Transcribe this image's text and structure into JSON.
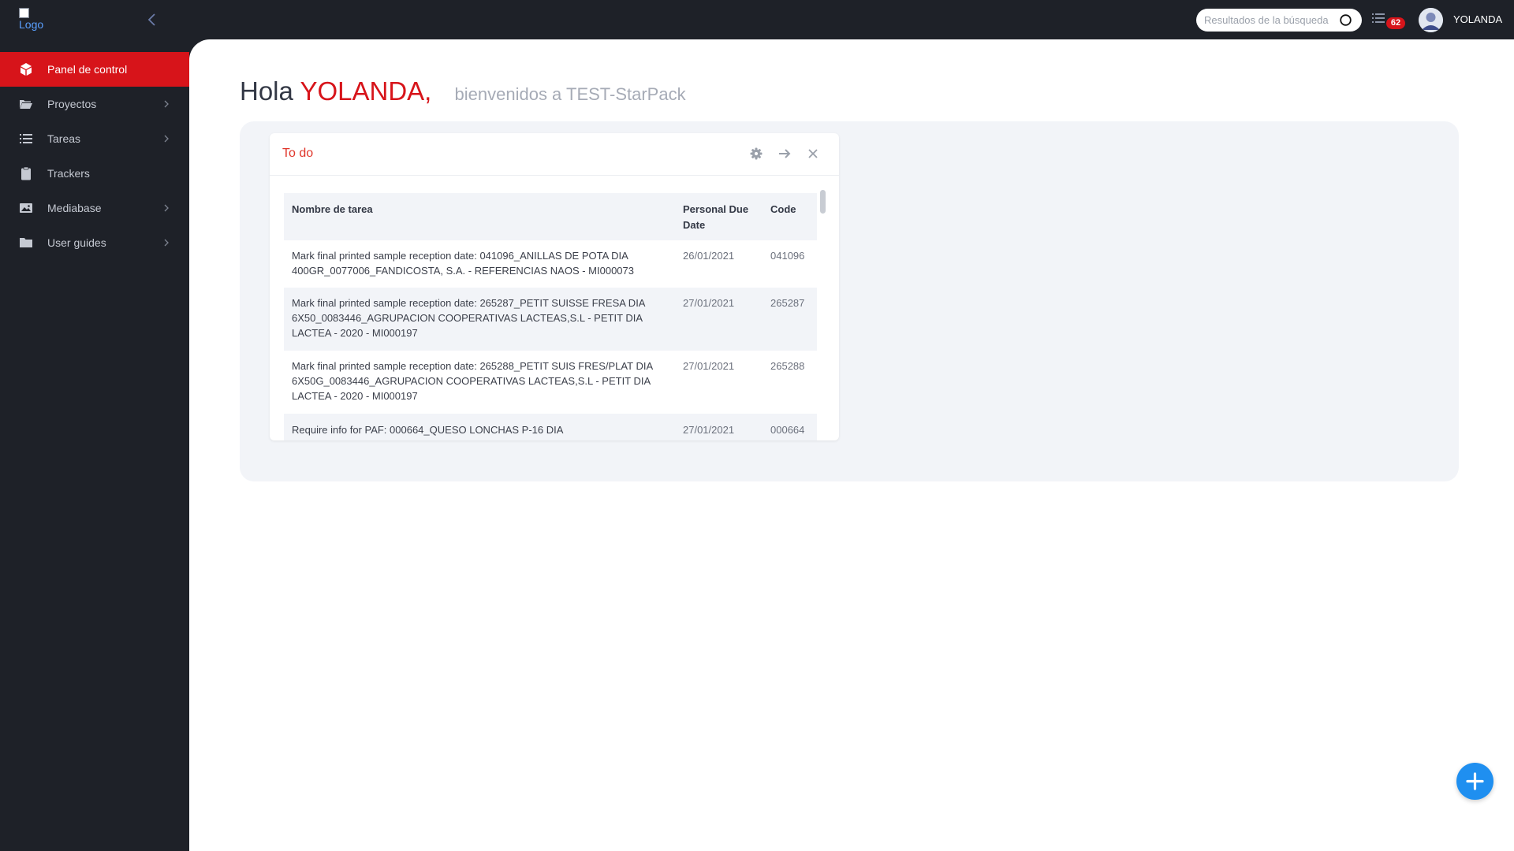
{
  "topbar": {
    "logo_alt": "Logo",
    "search_placeholder": "Resultados de la búsqueda",
    "tasks_badge": "62",
    "user_name": "YOLANDA"
  },
  "sidebar": {
    "items": [
      {
        "label": "Panel de control",
        "icon": "cube-icon",
        "active": true
      },
      {
        "label": "Proyectos",
        "icon": "folder-open-icon",
        "has_submenu": true
      },
      {
        "label": "Tareas",
        "icon": "list-icon",
        "has_submenu": true
      },
      {
        "label": "Trackers",
        "icon": "clipboard-icon"
      },
      {
        "label": "Mediabase",
        "icon": "image-icon",
        "has_submenu": true
      },
      {
        "label": "User guides",
        "icon": "folder-icon",
        "has_submenu": true
      }
    ]
  },
  "main": {
    "greeting_hello": "Hola",
    "greeting_name": "YOLANDA,",
    "greeting_welcome": "bienvenidos a TEST-StarPack",
    "widget": {
      "title": "To do",
      "columns": [
        "Nombre de tarea",
        "Personal Due Date",
        "Code"
      ],
      "rows": [
        {
          "task": "Mark final printed sample reception date: 041096_ANILLAS DE POTA DIA 400GR_0077006_FANDICOSTA, S.A. - REFERENCIAS NAOS - MI000073",
          "due": "26/01/2021",
          "code": "041096"
        },
        {
          "task": "Mark final printed sample reception date: 265287_PETIT SUISSE FRESA DIA 6X50_0083446_AGRUPACION COOPERATIVAS LACTEAS,S.L - PETIT DIA LACTEA - 2020 - MI000197",
          "due": "27/01/2021",
          "code": "265287"
        },
        {
          "task": "Mark final printed sample reception date: 265288_PETIT SUIS FRES/PLAT DIA 6X50G_0083446_AGRUPACION COOPERATIVAS LACTEAS,S.L - PETIT DIA LACTEA - 2020 - MI000197",
          "due": "27/01/2021",
          "code": "265288"
        },
        {
          "task": "Require info for PAF: 000664_QUESO LONCHAS P-16 DIA",
          "due": "27/01/2021",
          "code": "000664"
        }
      ]
    }
  },
  "colors": {
    "accent": "#d7141a",
    "sidebar_bg": "#1e2128",
    "fab": "#1f8ff0"
  }
}
